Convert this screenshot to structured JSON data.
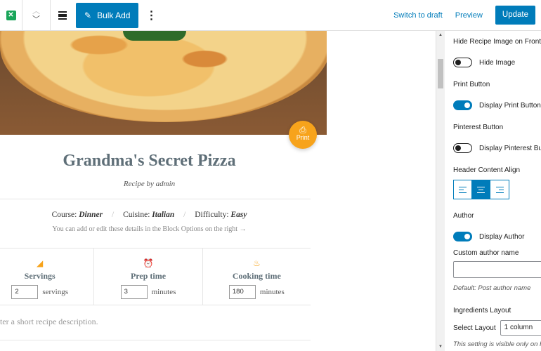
{
  "toolbar": {
    "logo_icon": "recipe-card-icon",
    "bulk_add_label": "Bulk Add",
    "more_icon": "⋮",
    "switch_to_draft": "Switch to draft",
    "preview": "Preview",
    "update": "Update"
  },
  "recipe": {
    "print_label": "Print",
    "title": "Grandma's Secret Pizza",
    "by": "Recipe by admin",
    "course_label": "Course:",
    "course": "Dinner",
    "cuisine_label": "Cuisine:",
    "cuisine": "Italian",
    "difficulty_label": "Difficulty:",
    "difficulty": "Easy",
    "hint": "You can add or edit these details in the Block Options on the right →",
    "details": [
      {
        "icon": "pizza-slice-icon",
        "label": "Servings",
        "value": "2",
        "unit": "servings"
      },
      {
        "icon": "alarm-clock-icon",
        "label": "Prep time",
        "value": "3",
        "unit": "minutes"
      },
      {
        "icon": "cooking-pot-icon",
        "label": "Cooking time",
        "value": "180",
        "unit": "minutes"
      }
    ],
    "description_placeholder": "ter a short recipe description."
  },
  "sidebar": {
    "hide_image_heading": "Hide Recipe Image on Front-end",
    "hide_image_toggle": "Hide Image",
    "hide_image_on": false,
    "print_heading": "Print Button",
    "print_toggle": "Display Print Button",
    "print_on": true,
    "pinterest_heading": "Pinterest Button",
    "pinterest_toggle": "Display Pinterest Button",
    "pinterest_on": false,
    "align_heading": "Header Content Align",
    "align_selected": "center",
    "author_heading": "Author",
    "author_toggle": "Display Author",
    "author_on": true,
    "custom_author_label": "Custom author name",
    "custom_author_value": "",
    "custom_author_help": "Default: Post author name",
    "ingredients_heading": "Ingredients Layout",
    "select_layout_label": "Select Layout",
    "select_layout_value": "1 column",
    "visibility_help": "This setting is visible only on Front-end"
  },
  "colors": {
    "accent": "#007cba",
    "orange": "#f7a31b",
    "title": "#5f6f78"
  }
}
